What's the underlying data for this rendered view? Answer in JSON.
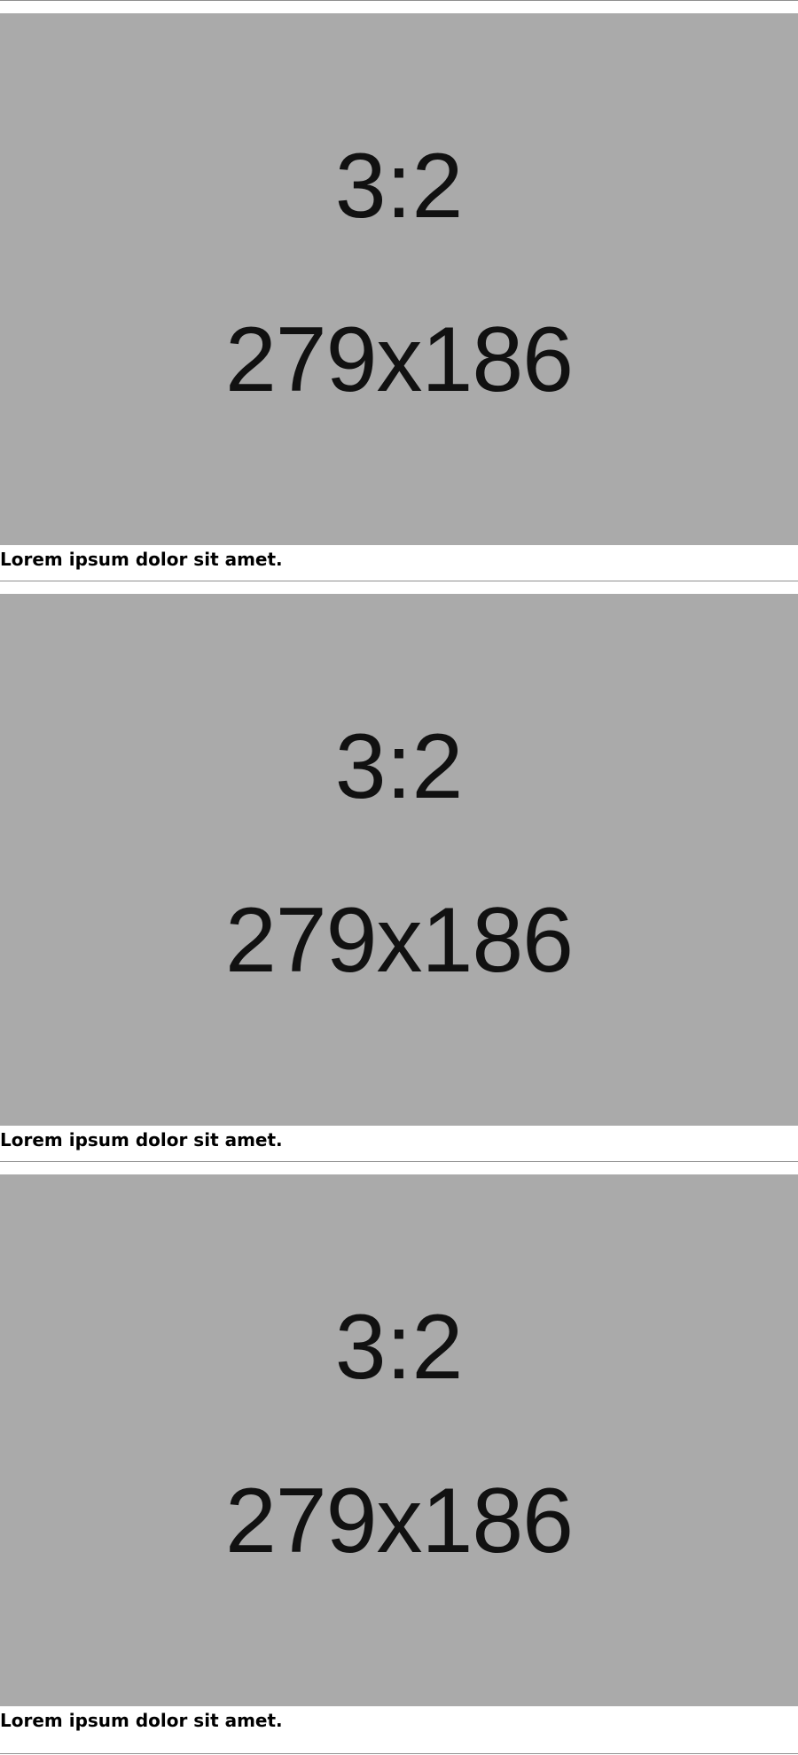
{
  "cards": [
    {
      "image_ratio": "3:2",
      "image_dims": "279x186",
      "caption": "Lorem ipsum dolor sit amet."
    },
    {
      "image_ratio": "3:2",
      "image_dims": "279x186",
      "caption": "Lorem ipsum dolor sit amet."
    },
    {
      "image_ratio": "3:2",
      "image_dims": "279x186",
      "caption": "Lorem ipsum dolor sit amet."
    }
  ]
}
